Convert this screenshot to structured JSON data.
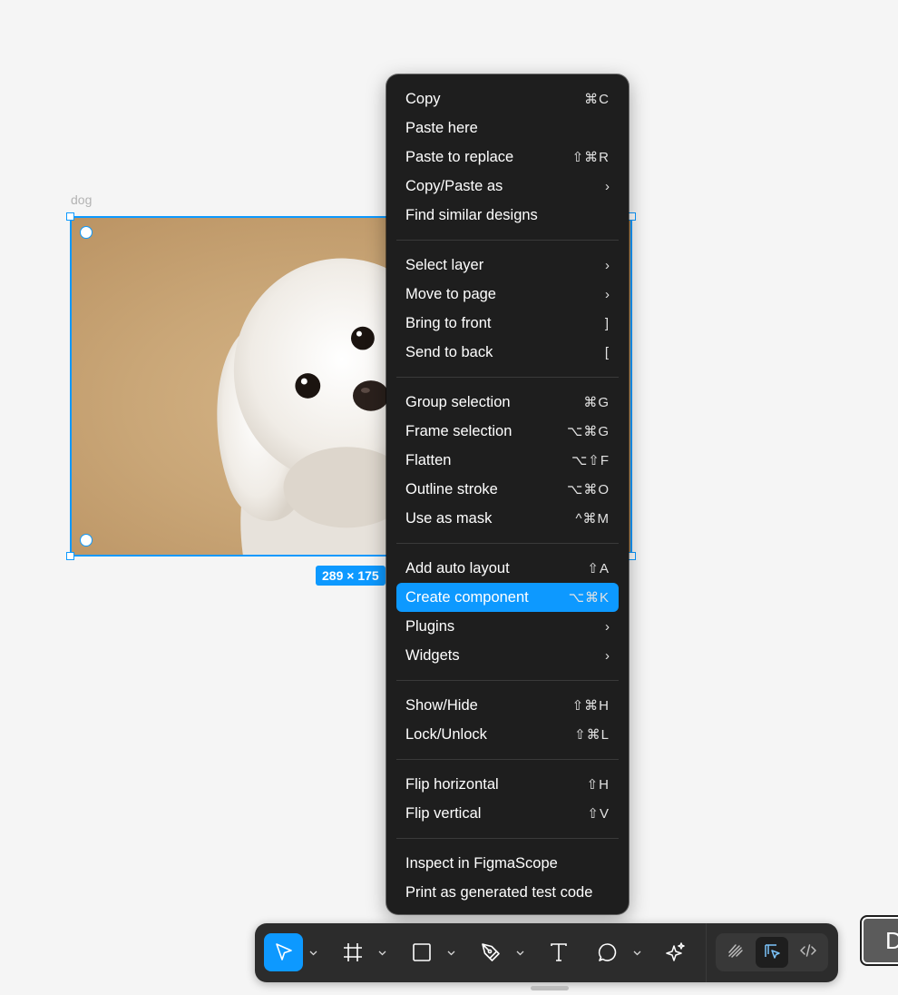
{
  "canvas": {
    "layer_name": "dog",
    "size_label": "289 × 175",
    "accent": "#0d99ff"
  },
  "context_menu": {
    "groups": [
      [
        {
          "label": "Copy",
          "shortcut": "⌘C"
        },
        {
          "label": "Paste here",
          "shortcut": ""
        },
        {
          "label": "Paste to replace",
          "shortcut": "⇧⌘R"
        },
        {
          "label": "Copy/Paste as",
          "submenu": true
        },
        {
          "label": "Find similar designs",
          "shortcut": ""
        }
      ],
      [
        {
          "label": "Select layer",
          "submenu": true
        },
        {
          "label": "Move to page",
          "submenu": true
        },
        {
          "label": "Bring to front",
          "shortcut": "]"
        },
        {
          "label": "Send to back",
          "shortcut": "["
        }
      ],
      [
        {
          "label": "Group selection",
          "shortcut": "⌘G"
        },
        {
          "label": "Frame selection",
          "shortcut": "⌥⌘G"
        },
        {
          "label": "Flatten",
          "shortcut": "⌥⇧F"
        },
        {
          "label": "Outline stroke",
          "shortcut": "⌥⌘O"
        },
        {
          "label": "Use as mask",
          "shortcut": "^⌘M"
        }
      ],
      [
        {
          "label": "Add auto layout",
          "shortcut": "⇧A"
        },
        {
          "label": "Create component",
          "shortcut": "⌥⌘K",
          "active": true
        },
        {
          "label": "Plugins",
          "submenu": true
        },
        {
          "label": "Widgets",
          "submenu": true
        }
      ],
      [
        {
          "label": "Show/Hide",
          "shortcut": "⇧⌘H"
        },
        {
          "label": "Lock/Unlock",
          "shortcut": "⇧⌘L"
        }
      ],
      [
        {
          "label": "Flip horizontal",
          "shortcut": "⇧H"
        },
        {
          "label": "Flip vertical",
          "shortcut": "⇧V"
        }
      ],
      [
        {
          "label": "Inspect in FigmaScope",
          "shortcut": ""
        },
        {
          "label": "Print as generated test code",
          "shortcut": ""
        }
      ]
    ],
    "submenu_glyph": "›"
  },
  "toolbar": {
    "tools": [
      {
        "name": "move-tool",
        "icon": "cursor-arrow-icon",
        "active": true,
        "has_caret": true
      },
      {
        "name": "frame-tool",
        "icon": "frame-hash-icon",
        "active": false,
        "has_caret": true
      },
      {
        "name": "shape-tool",
        "icon": "rectangle-icon",
        "active": false,
        "has_caret": true
      },
      {
        "name": "pen-tool",
        "icon": "pen-nib-icon",
        "active": false,
        "has_caret": true
      },
      {
        "name": "text-tool",
        "icon": "text-t-icon",
        "active": false,
        "has_caret": false
      },
      {
        "name": "comment-tool",
        "icon": "speech-bubble-icon",
        "active": false,
        "has_caret": true
      },
      {
        "name": "ai-tool",
        "icon": "sparkles-icon",
        "active": false,
        "has_caret": false
      }
    ],
    "modes": [
      {
        "name": "draw-mode",
        "icon": "draw-scribble-icon",
        "active": false
      },
      {
        "name": "design-mode",
        "icon": "design-cursor-icon",
        "active": true
      },
      {
        "name": "dev-mode",
        "icon": "code-brackets-icon",
        "active": false
      }
    ]
  },
  "side_button": {
    "label": "D"
  }
}
